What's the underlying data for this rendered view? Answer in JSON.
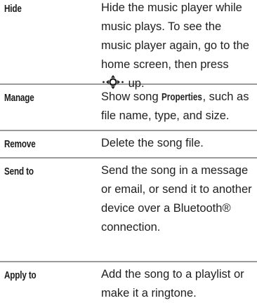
{
  "rows": [
    {
      "term": "Hide",
      "desc_pre": "Hide the music player while music plays. To see the music player again, go to the home screen, then press",
      "icon": "nav-key-icon",
      "desc_post": "up."
    },
    {
      "term": "Manage",
      "desc_pre": "Show song",
      "ui_term": "Properties",
      "desc_post": ", such as file name, type, and size."
    },
    {
      "term": "Remove",
      "desc": "Delete the song file."
    },
    {
      "term": "Send to",
      "desc": "Send the song in a message or email, or send it to another device over a Bluetooth® connection."
    },
    {
      "term": "Apply to",
      "desc": "Add the song to a playlist or make it a ringtone."
    }
  ]
}
